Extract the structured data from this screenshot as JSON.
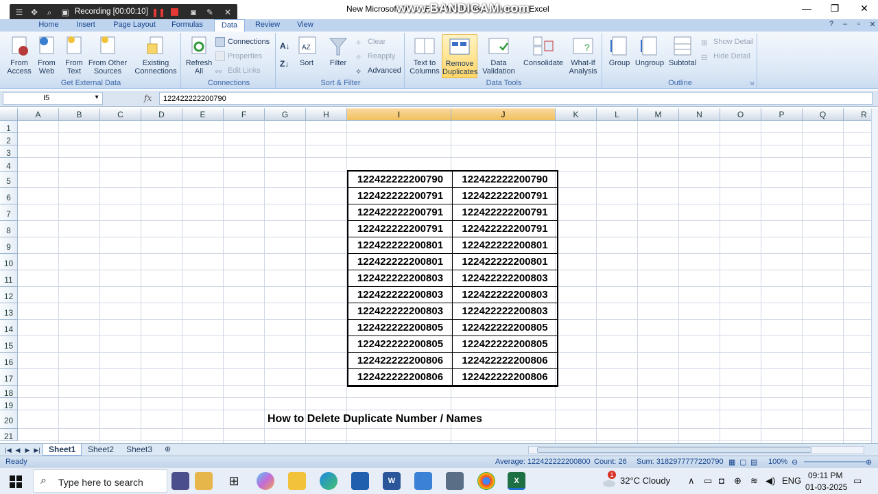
{
  "window": {
    "title": "New Microsoft Office Excel Worksheet - Microsoft Excel",
    "watermark": "www.BANDICAM.com"
  },
  "recording": {
    "label": "Recording [00:00:10]"
  },
  "tabs": [
    "Home",
    "Insert",
    "Page Layout",
    "Formulas",
    "Data",
    "Review",
    "View"
  ],
  "active_tab": "Data",
  "ribbon": {
    "external_data": {
      "label": "Get External Data",
      "from_access": [
        "From",
        "Access"
      ],
      "from_web": [
        "From",
        "Web"
      ],
      "from_text": [
        "From",
        "Text"
      ],
      "from_other": [
        "From Other",
        "Sources"
      ],
      "existing": [
        "Existing",
        "Connections"
      ]
    },
    "connections": {
      "label": "Connections",
      "refresh": [
        "Refresh",
        "All"
      ],
      "connections": "Connections",
      "properties": "Properties",
      "edit_links": "Edit Links"
    },
    "sort_filter": {
      "label": "Sort & Filter",
      "sort": "Sort",
      "filter": "Filter",
      "clear": "Clear",
      "reapply": "Reapply",
      "advanced": "Advanced"
    },
    "data_tools": {
      "label": "Data Tools",
      "text_to_columns": [
        "Text to",
        "Columns"
      ],
      "remove_duplicates": [
        "Remove",
        "Duplicates"
      ],
      "data_validation": [
        "Data",
        "Validation"
      ],
      "consolidate": "Consolidate",
      "what_if": [
        "What-If",
        "Analysis"
      ]
    },
    "outline": {
      "label": "Outline",
      "group": "Group",
      "ungroup": "Ungroup",
      "subtotal": "Subtotal",
      "show_detail": "Show Detail",
      "hide_detail": "Hide Detail"
    }
  },
  "formula_bar": {
    "name_box": "I5",
    "fx": "fx",
    "formula": "122422222200790"
  },
  "grid": {
    "columns": [
      "A",
      "B",
      "C",
      "D",
      "E",
      "F",
      "G",
      "H",
      "I",
      "J",
      "K",
      "L",
      "M",
      "N",
      "O",
      "P",
      "Q",
      "R"
    ],
    "rows": [
      "1",
      "2",
      "3",
      "4",
      "5",
      "6",
      "7",
      "8",
      "9",
      "10",
      "11",
      "12",
      "13",
      "14",
      "15",
      "16",
      "17",
      "18",
      "19",
      "20",
      "21"
    ],
    "data": [
      [
        "122422222200790",
        "122422222200790"
      ],
      [
        "122422222200791",
        "122422222200791"
      ],
      [
        "122422222200791",
        "122422222200791"
      ],
      [
        "122422222200791",
        "122422222200791"
      ],
      [
        "122422222200801",
        "122422222200801"
      ],
      [
        "122422222200801",
        "122422222200801"
      ],
      [
        "122422222200803",
        "122422222200803"
      ],
      [
        "122422222200803",
        "122422222200803"
      ],
      [
        "122422222200803",
        "122422222200803"
      ],
      [
        "122422222200805",
        "122422222200805"
      ],
      [
        "122422222200805",
        "122422222200805"
      ],
      [
        "122422222200806",
        "122422222200806"
      ],
      [
        "122422222200806",
        "122422222200806"
      ]
    ],
    "caption": "How to Delete Duplicate Number / Names"
  },
  "sheets": [
    "Sheet1",
    "Sheet2",
    "Sheet3"
  ],
  "status": {
    "ready": "Ready",
    "average": "Average: 122422222200800",
    "count": "Count: 26",
    "sum": "Sum: 3182977777220790",
    "zoom": "100%"
  },
  "taskbar": {
    "search_placeholder": "Type here to search",
    "weather": "32°C  Cloudy",
    "lang": "ENG",
    "time": "09:11 PM",
    "date": "01-03-2025",
    "weather_badge": "1"
  }
}
